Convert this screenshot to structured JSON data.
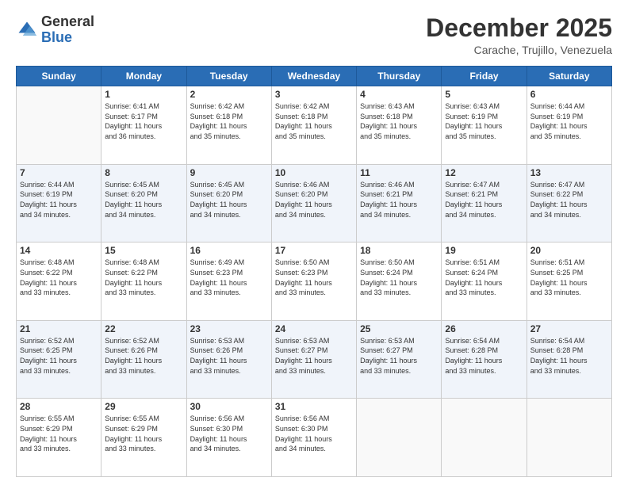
{
  "logo": {
    "general": "General",
    "blue": "Blue"
  },
  "header": {
    "month": "December 2025",
    "location": "Carache, Trujillo, Venezuela"
  },
  "weekdays": [
    "Sunday",
    "Monday",
    "Tuesday",
    "Wednesday",
    "Thursday",
    "Friday",
    "Saturday"
  ],
  "weeks": [
    [
      {
        "day": "",
        "info": ""
      },
      {
        "day": "1",
        "info": "Sunrise: 6:41 AM\nSunset: 6:17 PM\nDaylight: 11 hours\nand 36 minutes."
      },
      {
        "day": "2",
        "info": "Sunrise: 6:42 AM\nSunset: 6:18 PM\nDaylight: 11 hours\nand 35 minutes."
      },
      {
        "day": "3",
        "info": "Sunrise: 6:42 AM\nSunset: 6:18 PM\nDaylight: 11 hours\nand 35 minutes."
      },
      {
        "day": "4",
        "info": "Sunrise: 6:43 AM\nSunset: 6:18 PM\nDaylight: 11 hours\nand 35 minutes."
      },
      {
        "day": "5",
        "info": "Sunrise: 6:43 AM\nSunset: 6:19 PM\nDaylight: 11 hours\nand 35 minutes."
      },
      {
        "day": "6",
        "info": "Sunrise: 6:44 AM\nSunset: 6:19 PM\nDaylight: 11 hours\nand 35 minutes."
      }
    ],
    [
      {
        "day": "7",
        "info": "Sunrise: 6:44 AM\nSunset: 6:19 PM\nDaylight: 11 hours\nand 34 minutes."
      },
      {
        "day": "8",
        "info": "Sunrise: 6:45 AM\nSunset: 6:20 PM\nDaylight: 11 hours\nand 34 minutes."
      },
      {
        "day": "9",
        "info": "Sunrise: 6:45 AM\nSunset: 6:20 PM\nDaylight: 11 hours\nand 34 minutes."
      },
      {
        "day": "10",
        "info": "Sunrise: 6:46 AM\nSunset: 6:20 PM\nDaylight: 11 hours\nand 34 minutes."
      },
      {
        "day": "11",
        "info": "Sunrise: 6:46 AM\nSunset: 6:21 PM\nDaylight: 11 hours\nand 34 minutes."
      },
      {
        "day": "12",
        "info": "Sunrise: 6:47 AM\nSunset: 6:21 PM\nDaylight: 11 hours\nand 34 minutes."
      },
      {
        "day": "13",
        "info": "Sunrise: 6:47 AM\nSunset: 6:22 PM\nDaylight: 11 hours\nand 34 minutes."
      }
    ],
    [
      {
        "day": "14",
        "info": "Sunrise: 6:48 AM\nSunset: 6:22 PM\nDaylight: 11 hours\nand 33 minutes."
      },
      {
        "day": "15",
        "info": "Sunrise: 6:48 AM\nSunset: 6:22 PM\nDaylight: 11 hours\nand 33 minutes."
      },
      {
        "day": "16",
        "info": "Sunrise: 6:49 AM\nSunset: 6:23 PM\nDaylight: 11 hours\nand 33 minutes."
      },
      {
        "day": "17",
        "info": "Sunrise: 6:50 AM\nSunset: 6:23 PM\nDaylight: 11 hours\nand 33 minutes."
      },
      {
        "day": "18",
        "info": "Sunrise: 6:50 AM\nSunset: 6:24 PM\nDaylight: 11 hours\nand 33 minutes."
      },
      {
        "day": "19",
        "info": "Sunrise: 6:51 AM\nSunset: 6:24 PM\nDaylight: 11 hours\nand 33 minutes."
      },
      {
        "day": "20",
        "info": "Sunrise: 6:51 AM\nSunset: 6:25 PM\nDaylight: 11 hours\nand 33 minutes."
      }
    ],
    [
      {
        "day": "21",
        "info": "Sunrise: 6:52 AM\nSunset: 6:25 PM\nDaylight: 11 hours\nand 33 minutes."
      },
      {
        "day": "22",
        "info": "Sunrise: 6:52 AM\nSunset: 6:26 PM\nDaylight: 11 hours\nand 33 minutes."
      },
      {
        "day": "23",
        "info": "Sunrise: 6:53 AM\nSunset: 6:26 PM\nDaylight: 11 hours\nand 33 minutes."
      },
      {
        "day": "24",
        "info": "Sunrise: 6:53 AM\nSunset: 6:27 PM\nDaylight: 11 hours\nand 33 minutes."
      },
      {
        "day": "25",
        "info": "Sunrise: 6:53 AM\nSunset: 6:27 PM\nDaylight: 11 hours\nand 33 minutes."
      },
      {
        "day": "26",
        "info": "Sunrise: 6:54 AM\nSunset: 6:28 PM\nDaylight: 11 hours\nand 33 minutes."
      },
      {
        "day": "27",
        "info": "Sunrise: 6:54 AM\nSunset: 6:28 PM\nDaylight: 11 hours\nand 33 minutes."
      }
    ],
    [
      {
        "day": "28",
        "info": "Sunrise: 6:55 AM\nSunset: 6:29 PM\nDaylight: 11 hours\nand 33 minutes."
      },
      {
        "day": "29",
        "info": "Sunrise: 6:55 AM\nSunset: 6:29 PM\nDaylight: 11 hours\nand 33 minutes."
      },
      {
        "day": "30",
        "info": "Sunrise: 6:56 AM\nSunset: 6:30 PM\nDaylight: 11 hours\nand 34 minutes."
      },
      {
        "day": "31",
        "info": "Sunrise: 6:56 AM\nSunset: 6:30 PM\nDaylight: 11 hours\nand 34 minutes."
      },
      {
        "day": "",
        "info": ""
      },
      {
        "day": "",
        "info": ""
      },
      {
        "day": "",
        "info": ""
      }
    ]
  ]
}
